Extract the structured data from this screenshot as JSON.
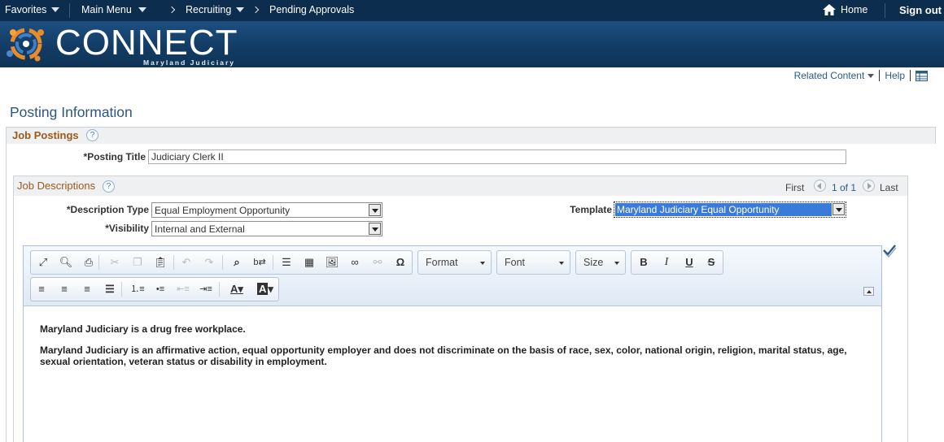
{
  "topnav": {
    "favorites": "Favorites",
    "main_menu": "Main Menu",
    "recruiting": "Recruiting",
    "pending_approvals": "Pending Approvals",
    "home": "Home",
    "sign_out": "Sign out"
  },
  "banner": {
    "brand": "CONNECT",
    "subtitle": "Maryland Judiciary"
  },
  "related": {
    "related_content": "Related Content",
    "help": "Help"
  },
  "page_title": "Posting Information",
  "job_postings": {
    "title": "Job Postings",
    "posting_title_label": "*Posting Title",
    "posting_title_value": "Judiciary Clerk II"
  },
  "job_descriptions": {
    "title": "Job Descriptions",
    "nav_first": "First",
    "nav_count": "1 of 1",
    "nav_last": "Last",
    "description_type_label": "*Description Type",
    "description_type_value": "Equal Employment Opportunity",
    "visibility_label": "*Visibility",
    "visibility_value": "Internal and External",
    "template_label": "Template",
    "template_value": "Maryland Judiciary Equal Opportunity"
  },
  "editor": {
    "format_label": "Format",
    "font_label": "Font",
    "size_label": "Size",
    "paragraph_1": "Maryland Judiciary is a drug free workplace.",
    "paragraph_2": "Maryland Judiciary is an affirmative action, equal opportunity employer and does not discriminate on the basis of race, sex, color, national origin, religion, marital status, age, sexual orientation, veteran status or disability in employment."
  },
  "icons": [
    "home-icon",
    "chevron-down-icon",
    "help-icon",
    "prev-icon",
    "next-icon",
    "maximize-icon",
    "preview-icon",
    "print-icon",
    "cut-icon",
    "copy-icon",
    "paste-icon",
    "undo-icon",
    "redo-icon",
    "find-icon",
    "replace-icon",
    "horizontal-rule-icon",
    "table-icon",
    "image-icon",
    "link-icon",
    "unlink-icon",
    "special-char-icon",
    "bold-icon",
    "italic-icon",
    "underline-icon",
    "strikethrough-icon",
    "align-left-icon",
    "align-center-icon",
    "align-right-icon",
    "justify-icon",
    "numbered-list-icon",
    "bulleted-list-icon",
    "outdent-icon",
    "indent-icon",
    "text-color-icon",
    "background-color-icon",
    "spellcheck-icon",
    "grid-icon"
  ],
  "colors": {
    "nav_bg": "#0d2d4f",
    "banner_bg": "#1c4f80",
    "section_title": "#9c5a17",
    "link": "#2a5a8f",
    "selection": "#3a7ad8"
  }
}
